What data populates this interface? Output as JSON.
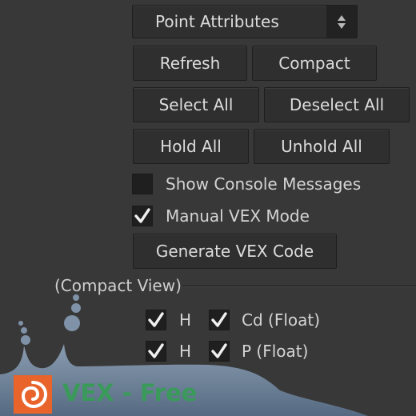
{
  "dropdown": {
    "value": "Point Attributes"
  },
  "buttons": {
    "refresh": "Refresh",
    "compact": "Compact",
    "select_all": "Select All",
    "deselect_all": "Deselect All",
    "hold_all": "Hold All",
    "unhold_all": "Unhold All",
    "generate_vex": "Generate VEX Code"
  },
  "options": {
    "show_console": {
      "label": "Show Console Messages",
      "checked": false
    },
    "manual_vex": {
      "label": "Manual VEX Mode",
      "checked": true
    }
  },
  "compact_view": {
    "title": "(Compact View)",
    "rows": [
      {
        "flag": "H",
        "attribute": "Cd (Float)"
      },
      {
        "flag": "H",
        "attribute": "P (Float)"
      }
    ]
  },
  "watermark": {
    "text": "VEX - Free",
    "accent": "#3a9a5a",
    "logo_color": "#e8642b",
    "bar_color": "#5c6f85"
  }
}
